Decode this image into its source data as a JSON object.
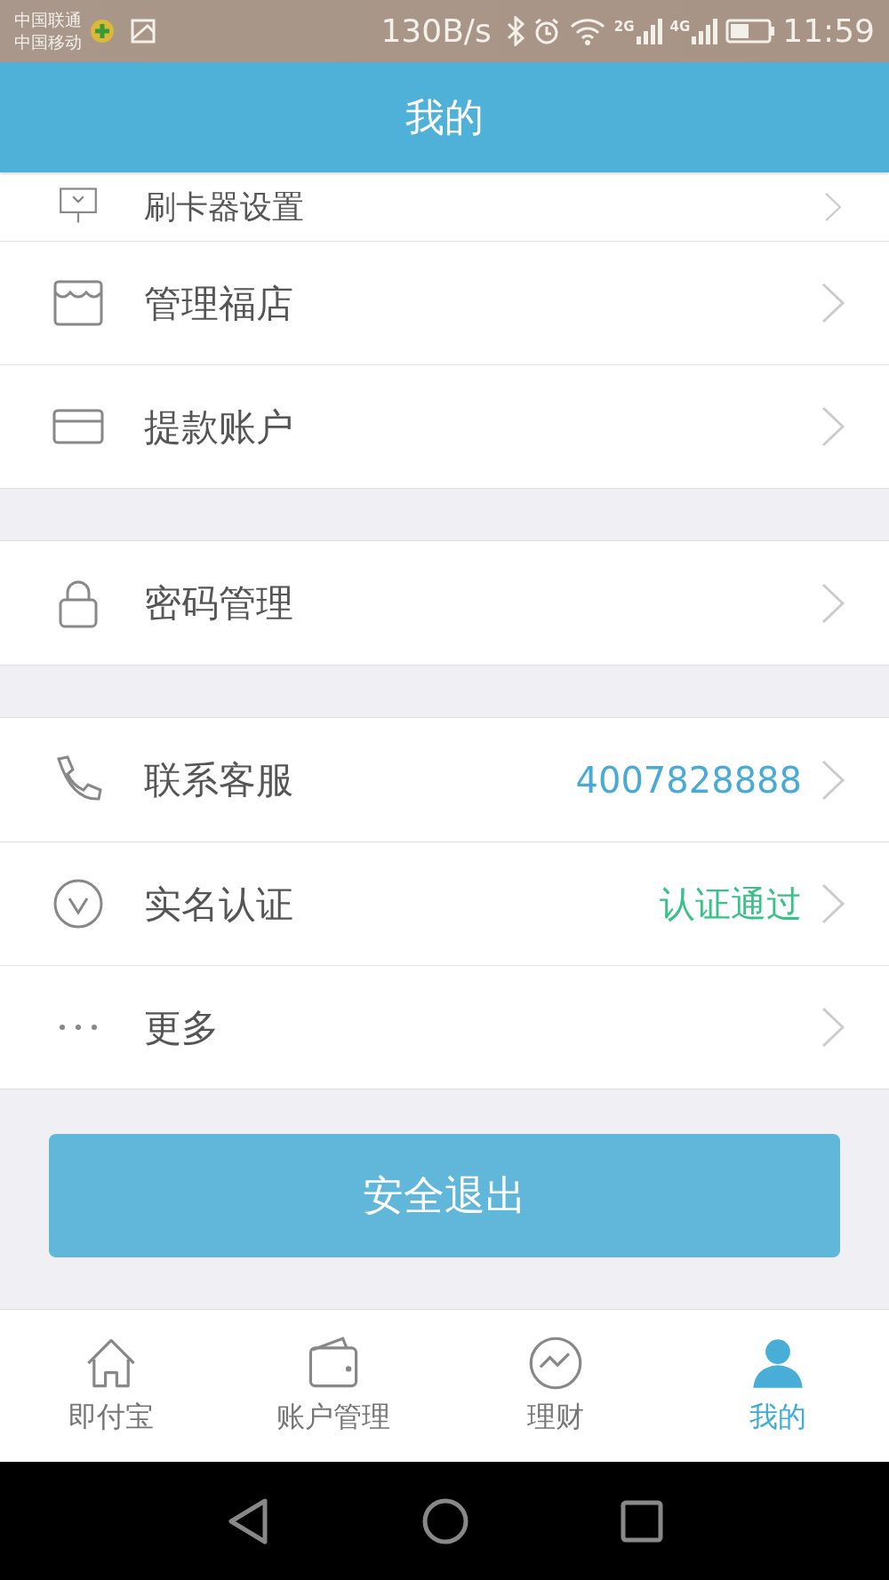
{
  "status_bar": {
    "carriers": [
      "中国联通",
      "中国移动"
    ],
    "speed": "130B/s",
    "network_labels": [
      "2G",
      "4G"
    ],
    "time": "11:59"
  },
  "header": {
    "title": "我的"
  },
  "groups": [
    {
      "items": [
        {
          "label": "刷卡器设置"
        },
        {
          "label": "管理福店"
        },
        {
          "label": "提款账户"
        }
      ]
    },
    {
      "items": [
        {
          "label": "密码管理"
        }
      ]
    },
    {
      "items": [
        {
          "label": "联系客服",
          "value": "4007828888",
          "color": "#4aaad6"
        },
        {
          "label": "实名认证",
          "value": "认证通过",
          "color": "#3cc08a"
        },
        {
          "label": "更多"
        }
      ]
    }
  ],
  "logout_button": "安全退出",
  "tabs": [
    {
      "label": "即付宝",
      "selected": false
    },
    {
      "label": "账户管理",
      "selected": false
    },
    {
      "label": "理财",
      "selected": false
    },
    {
      "label": "我的",
      "selected": true
    }
  ]
}
